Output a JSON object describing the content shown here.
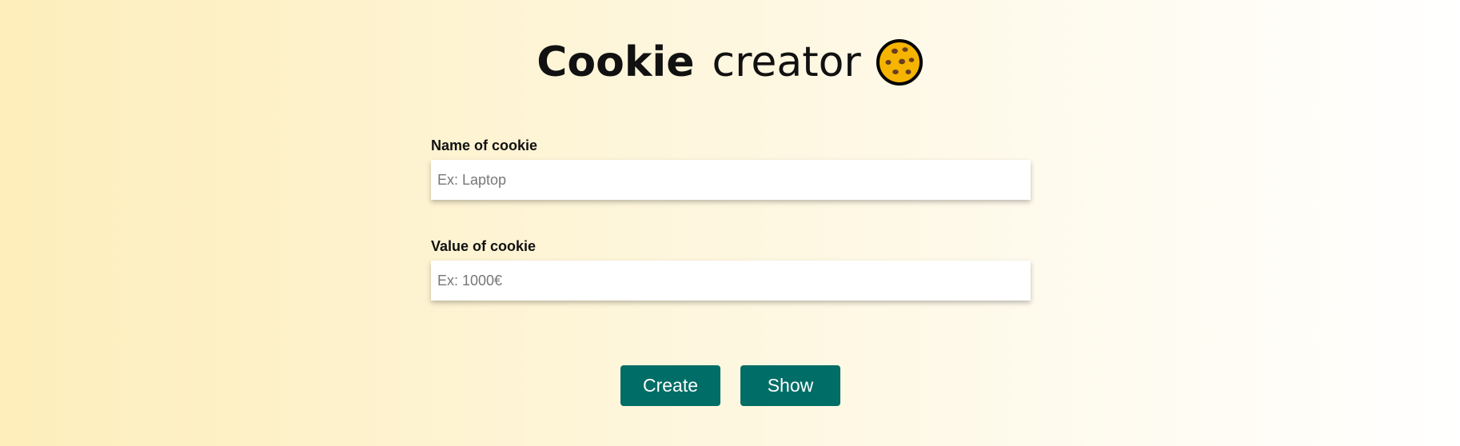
{
  "header": {
    "title_bold": "Cookie",
    "title_light": "creator",
    "icon": "cookie-icon"
  },
  "form": {
    "name_field": {
      "label": "Name of cookie",
      "placeholder": "Ex: Laptop",
      "value": ""
    },
    "value_field": {
      "label": "Value of cookie",
      "placeholder": "Ex: 1000€",
      "value": ""
    }
  },
  "actions": {
    "create_label": "Create",
    "show_label": "Show"
  },
  "colors": {
    "button_bg": "#006d66",
    "cookie_fill": "#f4b400",
    "cookie_chips": "#6b3e1f"
  }
}
